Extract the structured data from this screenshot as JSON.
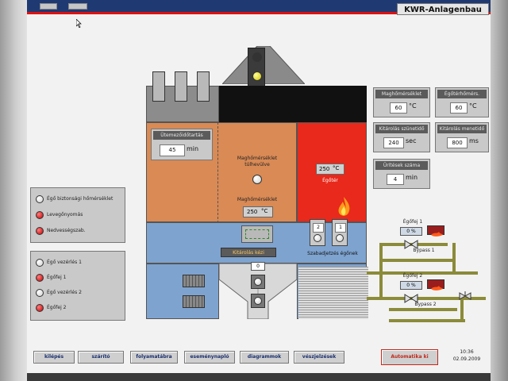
{
  "brand": "KWR-Anlagenbau",
  "left_panel_top": {
    "items": [
      {
        "label": "Égő biztonsági hőmérséklet",
        "state": "white"
      },
      {
        "label": "Levegőnyomás",
        "state": "red"
      },
      {
        "label": "Nedvességszab.",
        "state": "red"
      }
    ]
  },
  "left_panel_bottom": {
    "items": [
      {
        "label": "Égő vezérlés 1",
        "state": "white"
      },
      {
        "label": "Égőfej 1",
        "state": "red"
      },
      {
        "label": "Égő vezérlés 2",
        "state": "white"
      },
      {
        "label": "Égőfej 2",
        "state": "red"
      }
    ]
  },
  "dryer": {
    "residence_title": "Ütemezőidőtartás",
    "residence_value": "45",
    "residence_unit": "min",
    "overheat_label_line1": "Maghőmérséklet",
    "overheat_label_line2": "túlhevülve",
    "core_label": "Maghőmérséklet",
    "core_value": "250",
    "core_unit": "°C",
    "burner_value": "250",
    "burner_unit": "°C",
    "burner_label": "Égőtér",
    "free_burners_label": "Szabadjetzés égőnek",
    "burner_numbers": [
      "2",
      "1"
    ],
    "discharge_label": "Kitárolás kézi",
    "discharge_value": "0"
  },
  "right_panels": {
    "core_temp_title": "Maghőmérséklet",
    "core_temp_value": "60",
    "core_temp_unit": "°C",
    "burner_temp_title": "Égőtérhőmérs.",
    "burner_temp_value": "60",
    "burner_temp_unit": "°C",
    "discharge_interval_title": "Kitárolás szünetidő",
    "discharge_interval_value": "240",
    "discharge_interval_unit": "sec",
    "discharge_time_title": "Kitárolás menetidő",
    "discharge_time_value": "800",
    "discharge_time_unit": "ms",
    "cycle_count_title": "Ürítések száma",
    "cycle_count_value": "4",
    "cycle_count_unit": "min"
  },
  "gas": {
    "burner1_label": "Égőfej 1",
    "burner1_pct": "0 %",
    "bypass1_label": "Bypass 1",
    "burner2_label": "Égőfej 2",
    "burner2_pct": "0 %",
    "bypass2_label": "Bypass 2"
  },
  "nav": {
    "buttons": [
      "kilépés",
      "szárító",
      "folyamatábra",
      "eseménynapló",
      "diagrammok",
      "vészjelzések"
    ],
    "auto_button": "Automatika ki",
    "time": "10:36",
    "date": "02.09.2009"
  },
  "colors": {
    "orange_zone": "#d98a55",
    "blue_zone": "#7ea3cf",
    "red_zone": "#e8291b",
    "dark_gray": "#4a4a4a",
    "pipe_olive": "#8b8b3a"
  }
}
